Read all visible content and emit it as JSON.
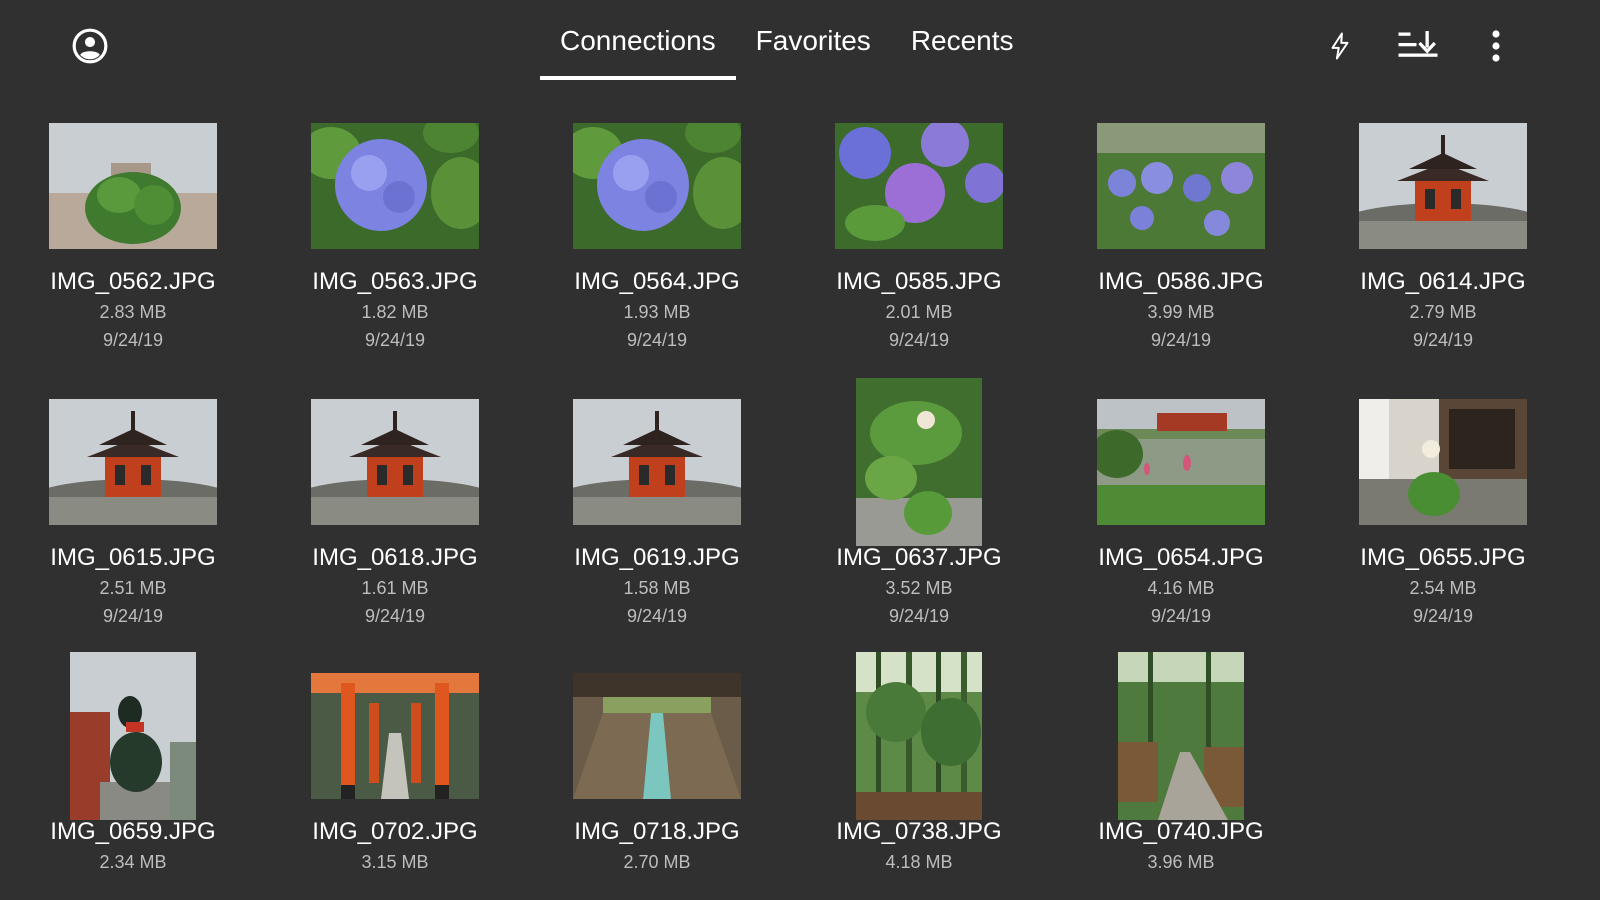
{
  "header": {
    "tabs": [
      {
        "label": "Connections",
        "active": true
      },
      {
        "label": "Favorites",
        "active": false
      },
      {
        "label": "Recents",
        "active": false
      }
    ],
    "icons": {
      "account": "account-circle-icon",
      "flash": "flash-icon",
      "sort": "sort-download-icon",
      "more": "more-vert-icon"
    }
  },
  "files": [
    {
      "name": "IMG_0562.JPG",
      "size": "2.83 MB",
      "date": "9/24/19",
      "scene": "bush"
    },
    {
      "name": "IMG_0563.JPG",
      "size": "1.82 MB",
      "date": "9/24/19",
      "scene": "hydrangea"
    },
    {
      "name": "IMG_0564.JPG",
      "size": "1.93 MB",
      "date": "9/24/19",
      "scene": "hydrangea"
    },
    {
      "name": "IMG_0585.JPG",
      "size": "2.01 MB",
      "date": "9/24/19",
      "scene": "hydrangea-purple"
    },
    {
      "name": "IMG_0586.JPG",
      "size": "3.99 MB",
      "date": "9/24/19",
      "scene": "hydrangea-field"
    },
    {
      "name": "IMG_0614.JPG",
      "size": "2.79 MB",
      "date": "9/24/19",
      "scene": "pagoda"
    },
    {
      "name": "IMG_0615.JPG",
      "size": "2.51 MB",
      "date": "9/24/19",
      "scene": "pagoda"
    },
    {
      "name": "IMG_0618.JPG",
      "size": "1.61 MB",
      "date": "9/24/19",
      "scene": "pagoda"
    },
    {
      "name": "IMG_0619.JPG",
      "size": "1.58 MB",
      "date": "9/24/19",
      "scene": "pagoda"
    },
    {
      "name": "IMG_0637.JPG",
      "size": "3.52 MB",
      "date": "9/24/19",
      "scene": "lotus-portrait"
    },
    {
      "name": "IMG_0654.JPG",
      "size": "4.16 MB",
      "date": "9/24/19",
      "scene": "pond"
    },
    {
      "name": "IMG_0655.JPG",
      "size": "2.54 MB",
      "date": "9/24/19",
      "scene": "lotus-house"
    },
    {
      "name": "IMG_0659.JPG",
      "size": "2.34 MB",
      "date": "",
      "scene": "fox-statue"
    },
    {
      "name": "IMG_0702.JPG",
      "size": "3.15 MB",
      "date": "",
      "scene": "torii"
    },
    {
      "name": "IMG_0718.JPG",
      "size": "2.70 MB",
      "date": "",
      "scene": "corridor"
    },
    {
      "name": "IMG_0738.JPG",
      "size": "4.18 MB",
      "date": "",
      "scene": "bamboo"
    },
    {
      "name": "IMG_0740.JPG",
      "size": "3.96 MB",
      "date": "",
      "scene": "bamboo-path"
    }
  ],
  "colors": {
    "background": "#303030",
    "text": "#ffffff",
    "secondary_text": "#bdbdbd",
    "tab_indicator": "#ffffff"
  }
}
